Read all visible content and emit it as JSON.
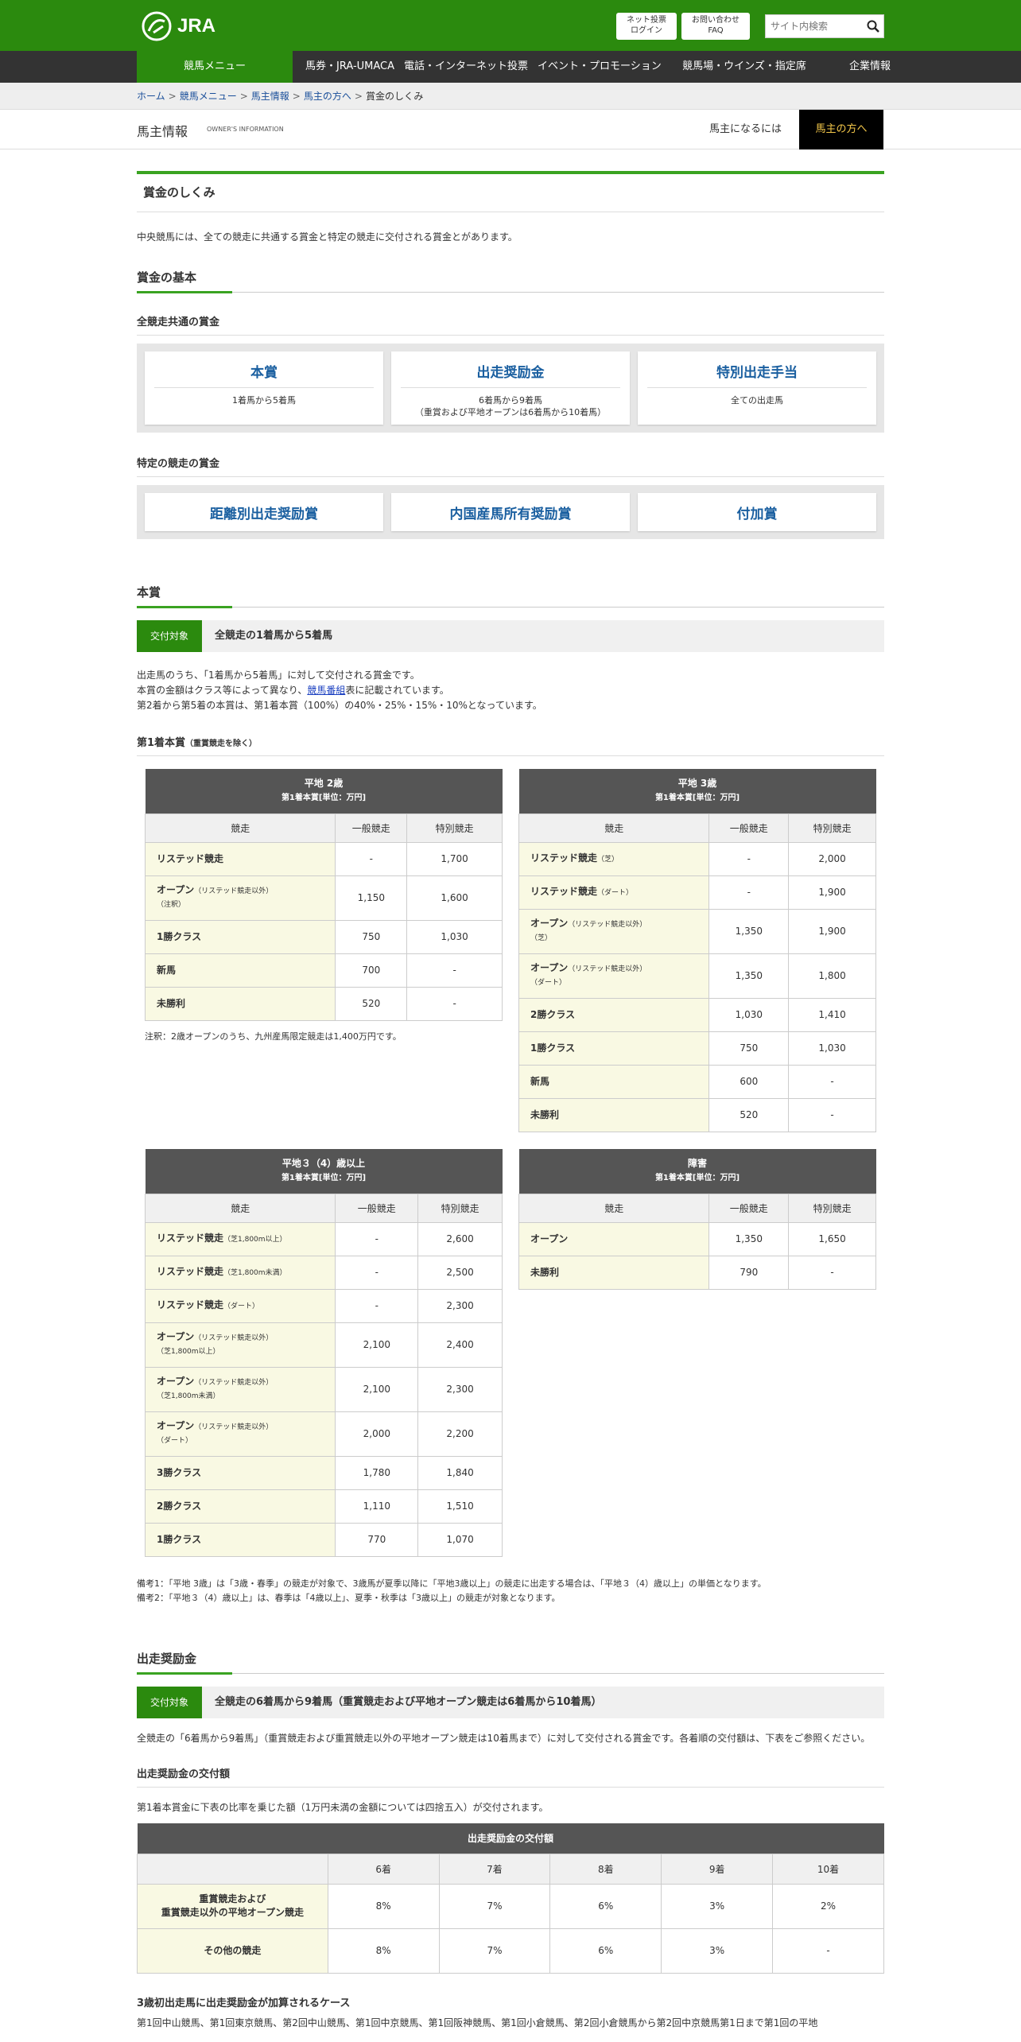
{
  "header": {
    "logo_text": "JRA",
    "login_label_1": "ネット投票",
    "login_label_2": "ログイン",
    "faq_label_1": "お問い合わせ",
    "faq_label_2": "FAQ",
    "search_placeholder": "サイト内検索"
  },
  "nav": [
    "競馬メニュー",
    "馬券・JRA-UMACA",
    "電話・インターネット投票",
    "イベント・プロモーション",
    "競馬場・ウインズ・指定席",
    "企業情報"
  ],
  "breadcrumb": [
    "ホーム",
    "競馬メニュー",
    "馬主情報",
    "馬主の方へ",
    "賞金のしくみ"
  ],
  "section": {
    "title": "馬主情報",
    "subtitle": "OWNER'S INFORMATION",
    "tab1": "馬主になるには",
    "tab2": "馬主の方へ"
  },
  "page": {
    "title": "賞金のしくみ",
    "intro": "中央競馬には、全ての競走に共通する賞金と特定の競走に交付される賞金とがあります。",
    "basic_heading": "賞金の基本",
    "common_heading": "全競走共通の賞金",
    "common_cards": [
      {
        "title": "本賞",
        "desc": "1着馬から5着馬",
        "desc2": ""
      },
      {
        "title": "出走奨励金",
        "desc": "6着馬から9着馬",
        "desc2": "（重賞および平地オープンは6着馬から10着馬）"
      },
      {
        "title": "特別出走手当",
        "desc": "全ての出走馬",
        "desc2": ""
      }
    ],
    "specific_heading": "特定の競走の賞金",
    "specific_cards": [
      "距離別出走奨励賞",
      "内国産馬所有奨励賞",
      "付加賞"
    ],
    "honsho_heading": "本賞",
    "target_label": "交付対象",
    "honsho_target": "全競走の1着馬から5着馬",
    "honsho_p1": "出走馬のうち、「1着馬から5着馬」に対して交付される賞金です。",
    "honsho_p2a": "本賞の金額はクラス等によって異なり、",
    "honsho_p2link": "競馬番組",
    "honsho_p2b": "表に記載されています。",
    "honsho_p3": "第2着から第5着の本賞は、第1着本賞（100%）の40%・25%・15%・10%となっています。",
    "first_prize_heading": "第1着本賞",
    "first_prize_sub": "（重賞競走を除く）",
    "col_race": "競走",
    "col_general": "一般競走",
    "col_special": "特別競走",
    "table_unit": "第1着本賞[単位：万円]",
    "t2": {
      "title": "平地 2歳",
      "rows": [
        [
          "リステッド競走",
          "",
          "-",
          "1,700",
          ""
        ],
        [
          "オープン",
          "（リステッド競走以外）",
          "1,150",
          "1,600",
          "（注釈）"
        ],
        [
          "1勝クラス",
          "",
          "750",
          "1,030",
          ""
        ],
        [
          "新馬",
          "",
          "700",
          "-",
          ""
        ],
        [
          "未勝利",
          "",
          "520",
          "-",
          ""
        ]
      ]
    },
    "t2_note": "注釈：2歳オープンのうち、九州産馬限定競走は1,400万円です。",
    "t3": {
      "title": "平地 3歳",
      "rows": [
        [
          "リステッド競走",
          "（芝）",
          "-",
          "2,000"
        ],
        [
          "リステッド競走",
          "（ダート）",
          "-",
          "1,900"
        ],
        [
          "オープン",
          "（リステッド競走以外）",
          "1,350",
          "1,900",
          "（芝）"
        ],
        [
          "オープン",
          "（リステッド競走以外）",
          "1,350",
          "1,800",
          "（ダート）"
        ],
        [
          "2勝クラス",
          "",
          "1,030",
          "1,410"
        ],
        [
          "1勝クラス",
          "",
          "750",
          "1,030"
        ],
        [
          "新馬",
          "",
          "600",
          "-"
        ],
        [
          "未勝利",
          "",
          "520",
          "-"
        ]
      ]
    },
    "t34": {
      "title": "平地３（4）歳以上",
      "rows": [
        [
          "リステッド競走",
          "（芝1,800m以上）",
          "-",
          "2,600",
          ""
        ],
        [
          "リステッド競走",
          "（芝1,800m未満）",
          "-",
          "2,500",
          ""
        ],
        [
          "リステッド競走",
          "（ダート）",
          "-",
          "2,300",
          ""
        ],
        [
          "オープン",
          "（リステッド競走以外）",
          "2,100",
          "2,400",
          "（芝1,800m以上）"
        ],
        [
          "オープン",
          "（リステッド競走以外）",
          "2,100",
          "2,300",
          "（芝1,800m未満）"
        ],
        [
          "オープン",
          "（リステッド競走以外）",
          "2,000",
          "2,200",
          "（ダート）"
        ],
        [
          "3勝クラス",
          "",
          "1,780",
          "1,840",
          ""
        ],
        [
          "2勝クラス",
          "",
          "1,110",
          "1,510",
          ""
        ],
        [
          "1勝クラス",
          "",
          "770",
          "1,070",
          ""
        ]
      ]
    },
    "tj": {
      "title": "障害",
      "rows": [
        [
          "オープン",
          "",
          "1,350",
          "1,650"
        ],
        [
          "未勝利",
          "",
          "790",
          "-"
        ]
      ]
    },
    "remark1": "備考1：「平地 3歳」は「3歳・春季」の競走が対象で、3歳馬が夏季以降に「平地3歳以上」の競走に出走する場合は、「平地３（4）歳以上」の単価となります。",
    "remark2": "備考2：「平地３（4）歳以上」は、春季は「4歳以上」、夏季・秋季は「3歳以上」の競走が対象となります。",
    "shusso_heading": "出走奨励金",
    "shusso_target": "全競走の6着馬から9着馬（重賞競走および平地オープン競走は6着馬から10着馬）",
    "shusso_p1": "全競走の「6着馬から9着馬」（重賞競走および重賞競走以外の平地オープン競走は10着馬まで）に対して交付される賞金です。各着順の交付額は、下表をご参照ください。",
    "shusso_amount_heading": "出走奨励金の交付額",
    "shusso_p2": "第1着本賞金に下表の比率を乗じた額（1万円未満の金額については四捨五入）が交付されます。",
    "dist_table": {
      "title": "出走奨励金の交付額",
      "cols": [
        "",
        "6着",
        "7着",
        "8着",
        "9着",
        "10着"
      ],
      "rows": [
        [
          "重賞競走および",
          "重賞競走以外の平地オープン競走",
          "8%",
          "7%",
          "6%",
          "3%",
          "2%"
        ],
        [
          "その他の競走",
          "",
          "8%",
          "7%",
          "6%",
          "3%",
          "-"
        ]
      ]
    },
    "bottom_heading": "3歳初出走馬に出走奨励金が加算されるケース",
    "bottom_text": "第1回中山競馬、第1回東京競馬、第2回中山競馬、第1回中京競馬、第1回阪神競馬、第1回小倉競馬、第2回小倉競馬から第2回中京競馬第1日まで第1回の平地"
  },
  "colors": {
    "green": "#2b8a0e",
    "accent": "#3aa321",
    "dark": "#333333",
    "link": "#1a5fa0"
  }
}
